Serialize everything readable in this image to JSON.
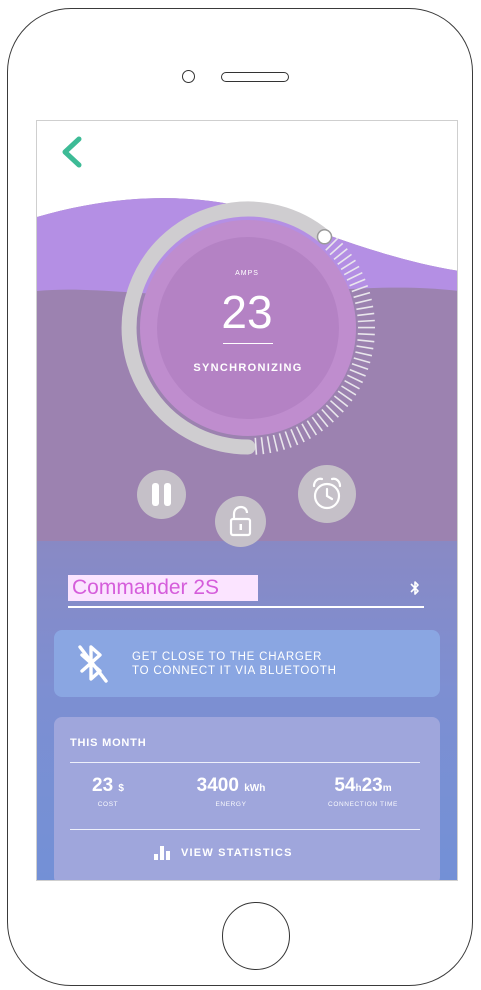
{
  "colors": {
    "accent": "#3dbb96",
    "wave_top": "#b48fe4",
    "gauge_fill": "#b482c4",
    "name_highlight_bg": "#fbe4ff",
    "name_highlight_text": "#d55ddb",
    "bt_card": "#8aa6e2",
    "stats_card": "#9fa6dc"
  },
  "nav": {
    "back_icon": "chevron-left-icon"
  },
  "gauge": {
    "label": "AMPS",
    "value": "23",
    "status": "SYNCHRONIZING"
  },
  "controls": {
    "pause_icon": "pause-icon",
    "lock_icon": "unlock-icon",
    "alarm_icon": "alarm-clock-icon"
  },
  "charger": {
    "name": "Commander 2S",
    "bluetooth_icon": "bluetooth-icon"
  },
  "bluetooth_card": {
    "icon": "bluetooth-off-icon",
    "line1": "GET CLOSE TO THE CHARGER",
    "line2": "TO CONNECT IT VIA BLUETOOTH"
  },
  "stats": {
    "title": "THIS MONTH",
    "cost": {
      "value": "23",
      "unit": "$",
      "label": "COST"
    },
    "energy": {
      "value": "3400",
      "unit": "kWh",
      "label": "ENERGY"
    },
    "time": {
      "hours": "54",
      "h_unit": "h",
      "minutes": "23",
      "m_unit": "m",
      "label": "CONNECTION TIME"
    },
    "view_label": "VIEW STATISTICS",
    "view_icon": "bar-chart-icon"
  }
}
